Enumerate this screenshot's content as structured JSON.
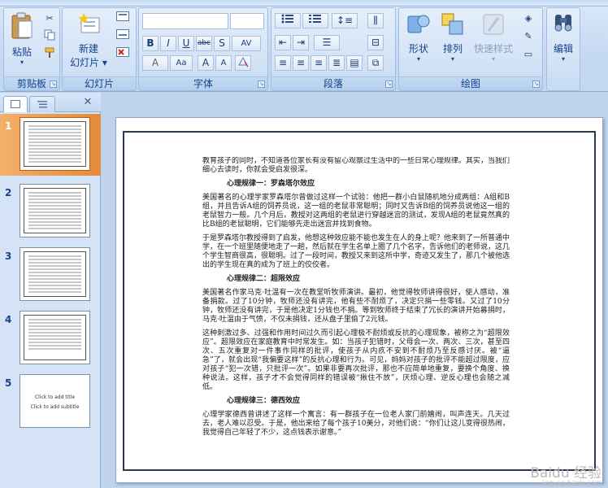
{
  "ribbon": {
    "paste_label": "粘贴",
    "new_slide_label_1": "新建",
    "new_slide_label_2": "幻灯片",
    "groups": {
      "clipboard": "剪贴板",
      "slides": "幻灯片",
      "font": "字体",
      "paragraph": "段落",
      "drawing": "绘图",
      "editing": "编辑"
    },
    "shape_label": "形状",
    "arrange_label": "排列",
    "quick_styles_label": "快速样式",
    "edit_label": "编辑",
    "font_buttons": [
      "B",
      "I",
      "U",
      "abc",
      "S",
      "AV"
    ],
    "font_size_buttons": [
      "A",
      "Aa",
      "A",
      "A"
    ]
  },
  "panel": {
    "close_glyph": "✕",
    "slides": [
      {
        "num": "1"
      },
      {
        "num": "2"
      },
      {
        "num": "3"
      },
      {
        "num": "4"
      },
      {
        "num": "5",
        "line1": "Click to add title",
        "line2": "Click to add subtitle"
      }
    ]
  },
  "slide": {
    "intro": "教育孩子的同时，不知道各位家长有没有留心观察过生活中的一些日常心理规律。其实，当我们细心去读时，你就会受启发很深。",
    "h1": "心理规律一：罗森塔尔效应",
    "p1": "美国著名的心理学家罗森塔尔曾做过这样一个试验：他把一群小白鼠随机地分成两组：A组和B组，并且告诉A组的饲养员说，这一组的老鼠非常聪明；同时又告诉B组的饲养员说他这一组的老鼠智力一般。几个月后，教授对这两组的老鼠进行穿越迷宫的测试，发现A组的老鼠竟然真的比B组的老鼠聪明，它们能够先走出迷宫并找到食物。",
    "p2": "于是罗森塔尔教授得到了启发，他想这种效应能不能也发生在人的身上呢？他来到了一所普通中学，在一个班里随便地走了一趟，然后就在学生名单上圈了几个名字，告诉他们的老师说，这几个学生智商很高，很聪明。过了一段时间，教授又来到这所中学，奇迹又发生了，那几个被他选出的学生现在真的成为了班上的佼佼者。",
    "h2": "心理规律二：超限效应",
    "p3": "美国著名作家马克·吐温有一次在教堂听牧师演讲。最初，他觉得牧师讲得很好，使人感动，准备捐款。过了10分钟，牧师还没有讲完，他有些不耐烦了，决定只捐一些零钱。又过了10分钟，牧师还没有讲完，于是他决定1分钱也不捐。等到牧师终于结束了冗长的演讲开始募捐时，马克·吐温由于气愤，不仅未捐钱，还从盘子里偷了2元钱。",
    "p4": "这种刺激过多、过强和作用时间过久而引起心理极不耐烦或反抗的心理现象，被称之为“超限效应”。超限效应在家庭教育中时常发生。如：当孩子犯错时，父母会一次、两次、三次，甚至四次、五次重复对一件事作同样的批评，使孩子从内疚不安到不耐烦乃至反感讨厌。被“逼急”了，就会出现“我偏要这样”的反抗心理和行为。可见，妈妈对孩子的批评不能超过限度，应对孩子“犯一次错，只批评一次”。如果非要再次批评，那也不应简单地重复，要换个角度、换种说法。这样，孩子才不会觉得同样的错误被“揪住不放”，厌烦心理、逆反心理也会随之减低。",
    "h3": "心理规律三：德西效应",
    "p5": "心理学家德西曾讲述了这样一个寓言：有一群孩子在一位老人家门前嬉闹，叫声连天。几天过去，老人难以忍受。于是，他出来给了每个孩子10美分，对他们说：“你们让这儿变得很热闹，我觉得自己年轻了不少，这点钱表示谢意。”"
  },
  "watermark": {
    "main": "Baidu 经验",
    "sub": "jingyan.baidu.com"
  }
}
